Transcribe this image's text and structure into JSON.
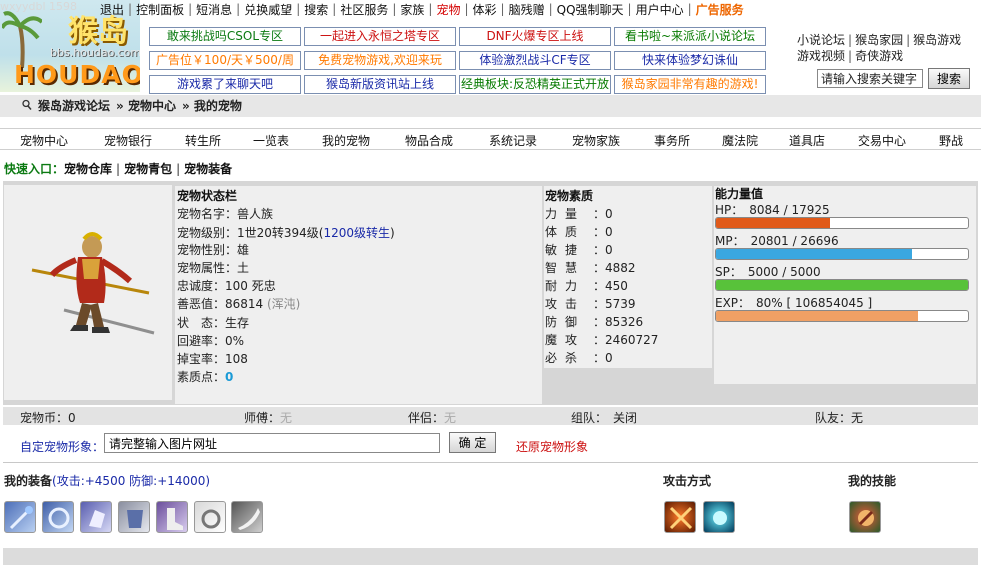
{
  "logo": {
    "title_cn": "猴岛",
    "url": "bbs.houdao.com",
    "brand": "HOUDAO",
    "watermark": "wxyydbl 1598"
  },
  "topnav": [
    {
      "label": "退出",
      "style": "normal"
    },
    {
      "label": "控制面板",
      "style": "normal"
    },
    {
      "label": "短消息",
      "style": "normal"
    },
    {
      "label": "兑换威望",
      "style": "normal"
    },
    {
      "label": "搜索",
      "style": "normal"
    },
    {
      "label": "社区服务",
      "style": "normal"
    },
    {
      "label": "家族",
      "style": "normal"
    },
    {
      "label": "宠物",
      "style": "red"
    },
    {
      "label": "体彩",
      "style": "normal"
    },
    {
      "label": "脑残赠",
      "style": "normal"
    },
    {
      "label": "QQ强制聊天",
      "style": "normal"
    },
    {
      "label": "用户中心",
      "style": "normal"
    },
    {
      "label": "广告服务",
      "style": "orange"
    }
  ],
  "ads": [
    {
      "text": "敢来挑战吗CSOL专区",
      "color": "green"
    },
    {
      "text": "一起进入永恒之塔专区",
      "color": "red"
    },
    {
      "text": "DNF火爆专区上线",
      "color": "red"
    },
    {
      "text": "看书啦~来派派小说论坛",
      "color": "darkgreen"
    },
    {
      "text": "广告位￥100/天￥500/周",
      "color": "orange"
    },
    {
      "text": "免费宠物游戏,欢迎来玩",
      "color": "orange"
    },
    {
      "text": "体验激烈战斗CF专区",
      "color": "blue"
    },
    {
      "text": "快来体验梦幻诛仙",
      "color": "blue"
    },
    {
      "text": "游戏累了来聊天吧",
      "color": "blue"
    },
    {
      "text": "猴岛新版资讯站上线",
      "color": "blue"
    },
    {
      "text": "经典板块:反恐精英正式开放",
      "color": "darkgreen"
    },
    {
      "text": "猴岛家园非常有趣的游戏!",
      "color": "orange"
    }
  ],
  "right_links": {
    "row1": [
      "小说论坛",
      "猴岛家园",
      "猴岛游戏"
    ],
    "row2": [
      "游戏视频",
      "奇侠游戏"
    ]
  },
  "search": {
    "value": "请输入搜索关键字",
    "button": "搜索"
  },
  "breadcrumb": [
    "猴岛游戏论坛",
    "» 宠物中心",
    "» 我的宠物"
  ],
  "tabs": [
    "宠物中心",
    "宠物银行",
    "转生所",
    "一览表",
    "我的宠物",
    "物品合成",
    "系统记录",
    "宠物家族",
    "事务所",
    "魔法院",
    "道具店",
    "交易中心",
    "野战"
  ],
  "quick": {
    "label": "快速入口：",
    "links": [
      "宠物仓库",
      "宠物青包",
      "宠物装备"
    ]
  },
  "status": {
    "title": "宠物状态栏",
    "name": "宠物名字：兽人族",
    "level_prefix": "宠物级别：1世20转394级(",
    "level_link": "1200级转生",
    "level_suffix": ")",
    "gender": "宠物性别：雄",
    "attr": "宠物属性：土",
    "loyalty": "忠诚度：100 死忠",
    "karma_prefix": "善恶值：86814 ",
    "karma_muted": "(浑沌)",
    "state": "状　态：生存",
    "evade": "回避率：0%",
    "drop": "掉宝率：108",
    "quality_pts_label": "素质点：",
    "quality_pts": "0"
  },
  "quality": {
    "title": "宠物素质",
    "rows": [
      {
        "k": "力量",
        "v": "：0"
      },
      {
        "k": "体质",
        "v": "：0"
      },
      {
        "k": "敏捷",
        "v": "：0"
      },
      {
        "k": "智慧",
        "v": "：4882"
      },
      {
        "k": "耐力",
        "v": "：450"
      },
      {
        "k": "攻击",
        "v": "：5739"
      },
      {
        "k": "防御",
        "v": "：85326"
      },
      {
        "k": "魔攻",
        "v": "：2460727"
      },
      {
        "k": "必杀",
        "v": "：0"
      }
    ]
  },
  "ability": {
    "title": "能力量值",
    "hp": {
      "label": "HP：　8084 / 17925",
      "fraction": 0.451
    },
    "mp": {
      "label": "MP：　20801 / 26696",
      "fraction": 0.779
    },
    "sp": {
      "label": "SP：　5000 / 5000",
      "fraction": 1.0
    },
    "exp": {
      "label": "EXP：　80% [ 106854045 ]",
      "fraction": 0.8
    },
    "colors": {
      "hp": "#e05a1a",
      "mp": "#3aa7e0",
      "sp": "#58c23a",
      "exp": "#f0a064"
    }
  },
  "info": {
    "coins": "宠物币：0",
    "master_label": "师傅：",
    "master": "无",
    "partner_label": "伴侣：",
    "partner": "无",
    "team": "组队：　关闭",
    "teammate": "队友：无"
  },
  "custom": {
    "label": "自定宠物形象：",
    "input_value": "请完整输入图片网址",
    "button": "确 定",
    "restore": "还原宠物形象"
  },
  "equip": {
    "title": "我的装备",
    "stats": "(攻击:+4500 防御:+14000)",
    "attack_title": "攻击方式",
    "skill_title": "我的技能"
  }
}
